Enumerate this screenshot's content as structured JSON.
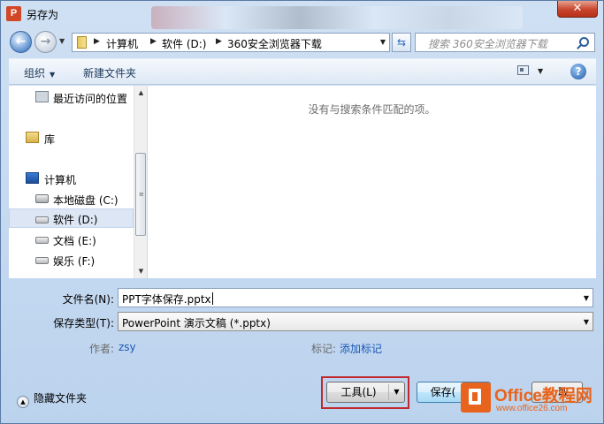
{
  "window": {
    "title": "另存为",
    "app_icon_letter": "P",
    "close_glyph": "✕"
  },
  "nav": {
    "back_glyph": "←",
    "breadcrumbs": [
      "计算机",
      "软件 (D:)",
      "360安全浏览器下载"
    ],
    "refresh_glyph": "⇆",
    "search_placeholder": "搜索 360安全浏览器下载"
  },
  "toolbar": {
    "organize": "组织",
    "new_folder": "新建文件夹",
    "help_glyph": "?"
  },
  "navpane": {
    "items": [
      {
        "label": "最近访问的位置",
        "icon": "recent-places-icon"
      },
      {
        "label": "库",
        "icon": "library-icon"
      },
      {
        "label": "计算机",
        "icon": "computer-icon"
      },
      {
        "label": "本地磁盘 (C:)",
        "icon": "system-drive-icon"
      },
      {
        "label": "软件 (D:)",
        "icon": "drive-icon",
        "selected": true
      },
      {
        "label": "文档 (E:)",
        "icon": "drive-icon"
      },
      {
        "label": "娱乐 (F:)",
        "icon": "drive-icon"
      }
    ]
  },
  "content": {
    "empty_message": "没有与搜索条件匹配的项。"
  },
  "form": {
    "filename_label": "文件名(N):",
    "filename_value": "PPT字体保存.pptx",
    "filetype_label": "保存类型(T):",
    "filetype_value": "PowerPoint 演示文稿 (*.pptx)",
    "author_label": "作者:",
    "author_value": "zsy",
    "tags_label": "标记:",
    "tags_value": "添加标记"
  },
  "footer": {
    "hide_folders": "隐藏文件夹",
    "tools_button": "工具(L)",
    "save_button": "保存(",
    "cancel_button": "取"
  },
  "watermark": {
    "title": "Office教程网",
    "url": "www.office26.com"
  },
  "colors": {
    "highlight_frame": "#c1272d",
    "watermark": "#e8631c",
    "link": "#1a57b5"
  }
}
